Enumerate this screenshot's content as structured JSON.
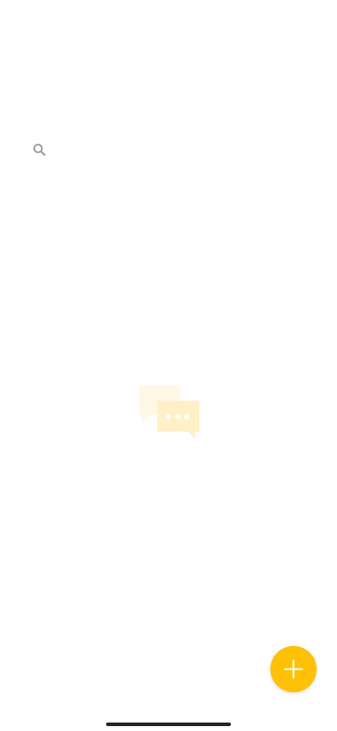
{
  "search": {
    "icon": "search-icon",
    "placeholder": "",
    "value": ""
  },
  "empty_state": {
    "icon": "chat-bubbles-icon"
  },
  "fab": {
    "icon": "plus-icon"
  },
  "colors": {
    "background": "#ffffff",
    "accent": "#FFC107",
    "accent_light_1": "#FFF8E6",
    "accent_light_2": "#FFF0C7",
    "search_icon": "#9E9E9E",
    "home_indicator": "#222222"
  }
}
